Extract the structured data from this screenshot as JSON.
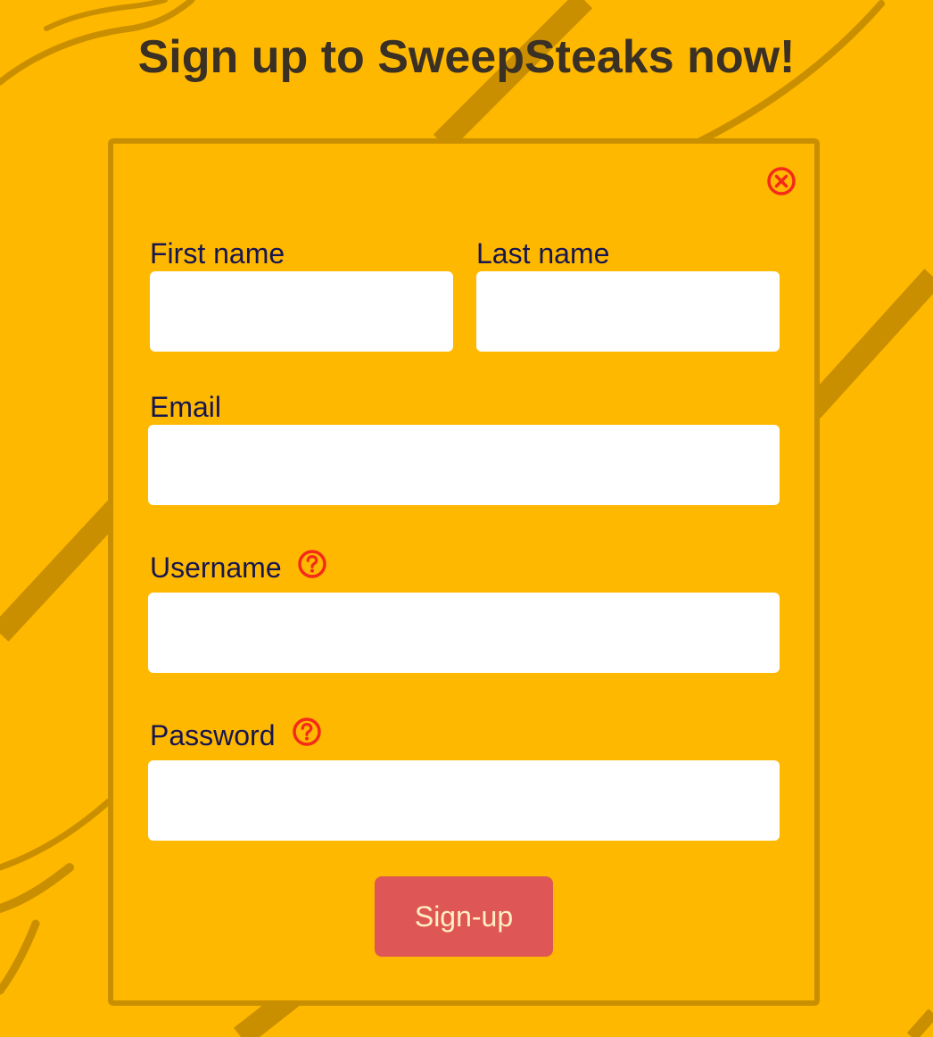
{
  "page": {
    "title": "Sign up to SweepSteaks now!"
  },
  "form": {
    "close_icon": "close-circle-icon",
    "first_name": {
      "label": "First name",
      "value": "",
      "placeholder": ""
    },
    "last_name": {
      "label": "Last name",
      "value": "",
      "placeholder": ""
    },
    "email": {
      "label": "Email",
      "value": "",
      "placeholder": ""
    },
    "username": {
      "label": "Username",
      "value": "",
      "placeholder": "",
      "help_icon": "question-circle-icon"
    },
    "password": {
      "label": "Password",
      "value": "",
      "placeholder": "",
      "help_icon": "question-circle-icon"
    },
    "submit_label": "Sign-up"
  },
  "colors": {
    "background": "#FFB800",
    "panel_border": "#C98F00",
    "title_text": "#3a3024",
    "label_text": "#161650",
    "icon_red": "#F42A1A",
    "button_bg": "#DE5656",
    "button_text": "#FFEFC2"
  }
}
